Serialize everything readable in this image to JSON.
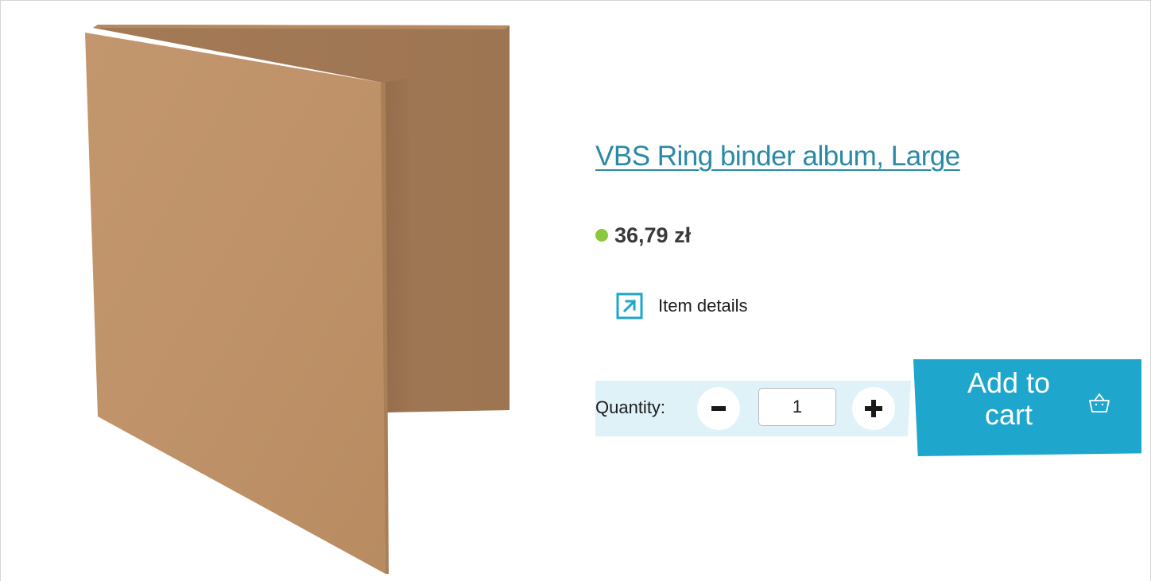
{
  "product": {
    "title": "VBS Ring binder album, Large",
    "price": "36,79 zł",
    "availability_color": "#8dc63f",
    "image_icon": "ring-binder-image"
  },
  "details": {
    "label": "Item details",
    "icon": "external-link-icon"
  },
  "quantity": {
    "label": "Quantity:",
    "value": "1",
    "decrement_icon": "minus-icon",
    "increment_icon": "plus-icon"
  },
  "cart": {
    "button_label": "Add to cart",
    "icon": "basket-icon"
  },
  "colors": {
    "accent": "#1ea6cc",
    "link": "#2a8aa6",
    "quantity_band": "#dff2f8"
  }
}
